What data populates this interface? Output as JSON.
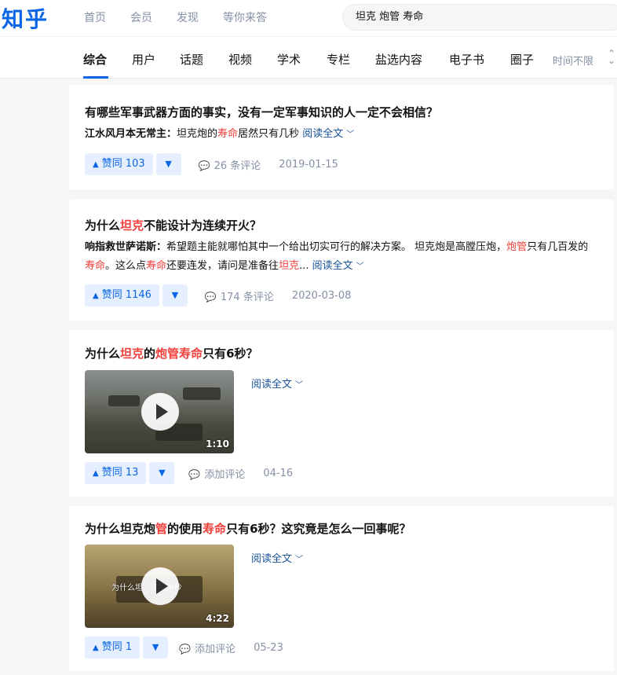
{
  "header": {
    "logo": "知乎",
    "nav": [
      "首页",
      "会员",
      "发现",
      "等你来答"
    ],
    "search_value": "坦克 炮管 寿命"
  },
  "tabs": {
    "items": [
      "综合",
      "用户",
      "话题",
      "视频",
      "学术",
      "专栏",
      "盐选内容",
      "电子书",
      "圈子"
    ],
    "active": "综合",
    "time_filter": "时间不限"
  },
  "results": [
    {
      "title_parts": [
        {
          "t": "有哪些军事武器方面的事实，没有一定军事知识的人一定不会相信？",
          "hl": false
        }
      ],
      "author": "江水风月本无常主",
      "excerpt_parts": [
        {
          "t": "坦克炮的",
          "hl": false
        },
        {
          "t": "寿命",
          "hl": true
        },
        {
          "t": "居然只有几秒",
          "hl": false
        }
      ],
      "read_more": "阅读全文",
      "votes": "赞同 103",
      "comments": "26 条评论",
      "date": "2019-01-15"
    },
    {
      "title_parts": [
        {
          "t": "为什么",
          "hl": false
        },
        {
          "t": "坦克",
          "hl": true
        },
        {
          "t": "不能设计为连续开火？",
          "hl": false
        }
      ],
      "author": "响指救世萨诺斯",
      "excerpt_parts": [
        {
          "t": "希望题主能就哪怕其中一个给出切实可行的解决方案。 坦克炮是高膛压炮，",
          "hl": false
        },
        {
          "t": "炮管",
          "hl": true
        },
        {
          "t": "只有几百发的",
          "hl": false
        },
        {
          "t": "寿命",
          "hl": true
        },
        {
          "t": "。这么点",
          "hl": false
        },
        {
          "t": "寿命",
          "hl": true
        },
        {
          "t": "还要连发，请问是准备往",
          "hl": false
        },
        {
          "t": "坦克",
          "hl": true
        },
        {
          "t": "...",
          "hl": false
        }
      ],
      "read_more": "阅读全文",
      "votes": "赞同 1146",
      "comments": "174 条评论",
      "date": "2020-03-08"
    },
    {
      "title_parts": [
        {
          "t": "为什么",
          "hl": false
        },
        {
          "t": "坦克",
          "hl": true
        },
        {
          "t": "的",
          "hl": false
        },
        {
          "t": "炮管寿命",
          "hl": true
        },
        {
          "t": "只有6秒？",
          "hl": false
        }
      ],
      "video_duration": "1:10",
      "read_more": "阅读全文",
      "votes": "赞同 13",
      "comments": "添加评论",
      "date": "04-16"
    },
    {
      "title_parts": [
        {
          "t": "为什么坦克炮",
          "hl": false
        },
        {
          "t": "管",
          "hl": true
        },
        {
          "t": "的使用",
          "hl": false
        },
        {
          "t": "寿命",
          "hl": true
        },
        {
          "t": "只有6秒？这究竟是怎么一回事呢？",
          "hl": false
        }
      ],
      "video_duration": "4:22",
      "video_overlay": "为什么坦… 只有6秒",
      "read_more": "阅读全文",
      "votes": "赞同 1",
      "comments": "添加评论",
      "date": "05-23"
    }
  ],
  "colors": {
    "brand": "#0a66e6",
    "highlight": "#f1403c",
    "link": "#175199",
    "muted": "#8590a6",
    "vote_bg": "#e5efff"
  }
}
